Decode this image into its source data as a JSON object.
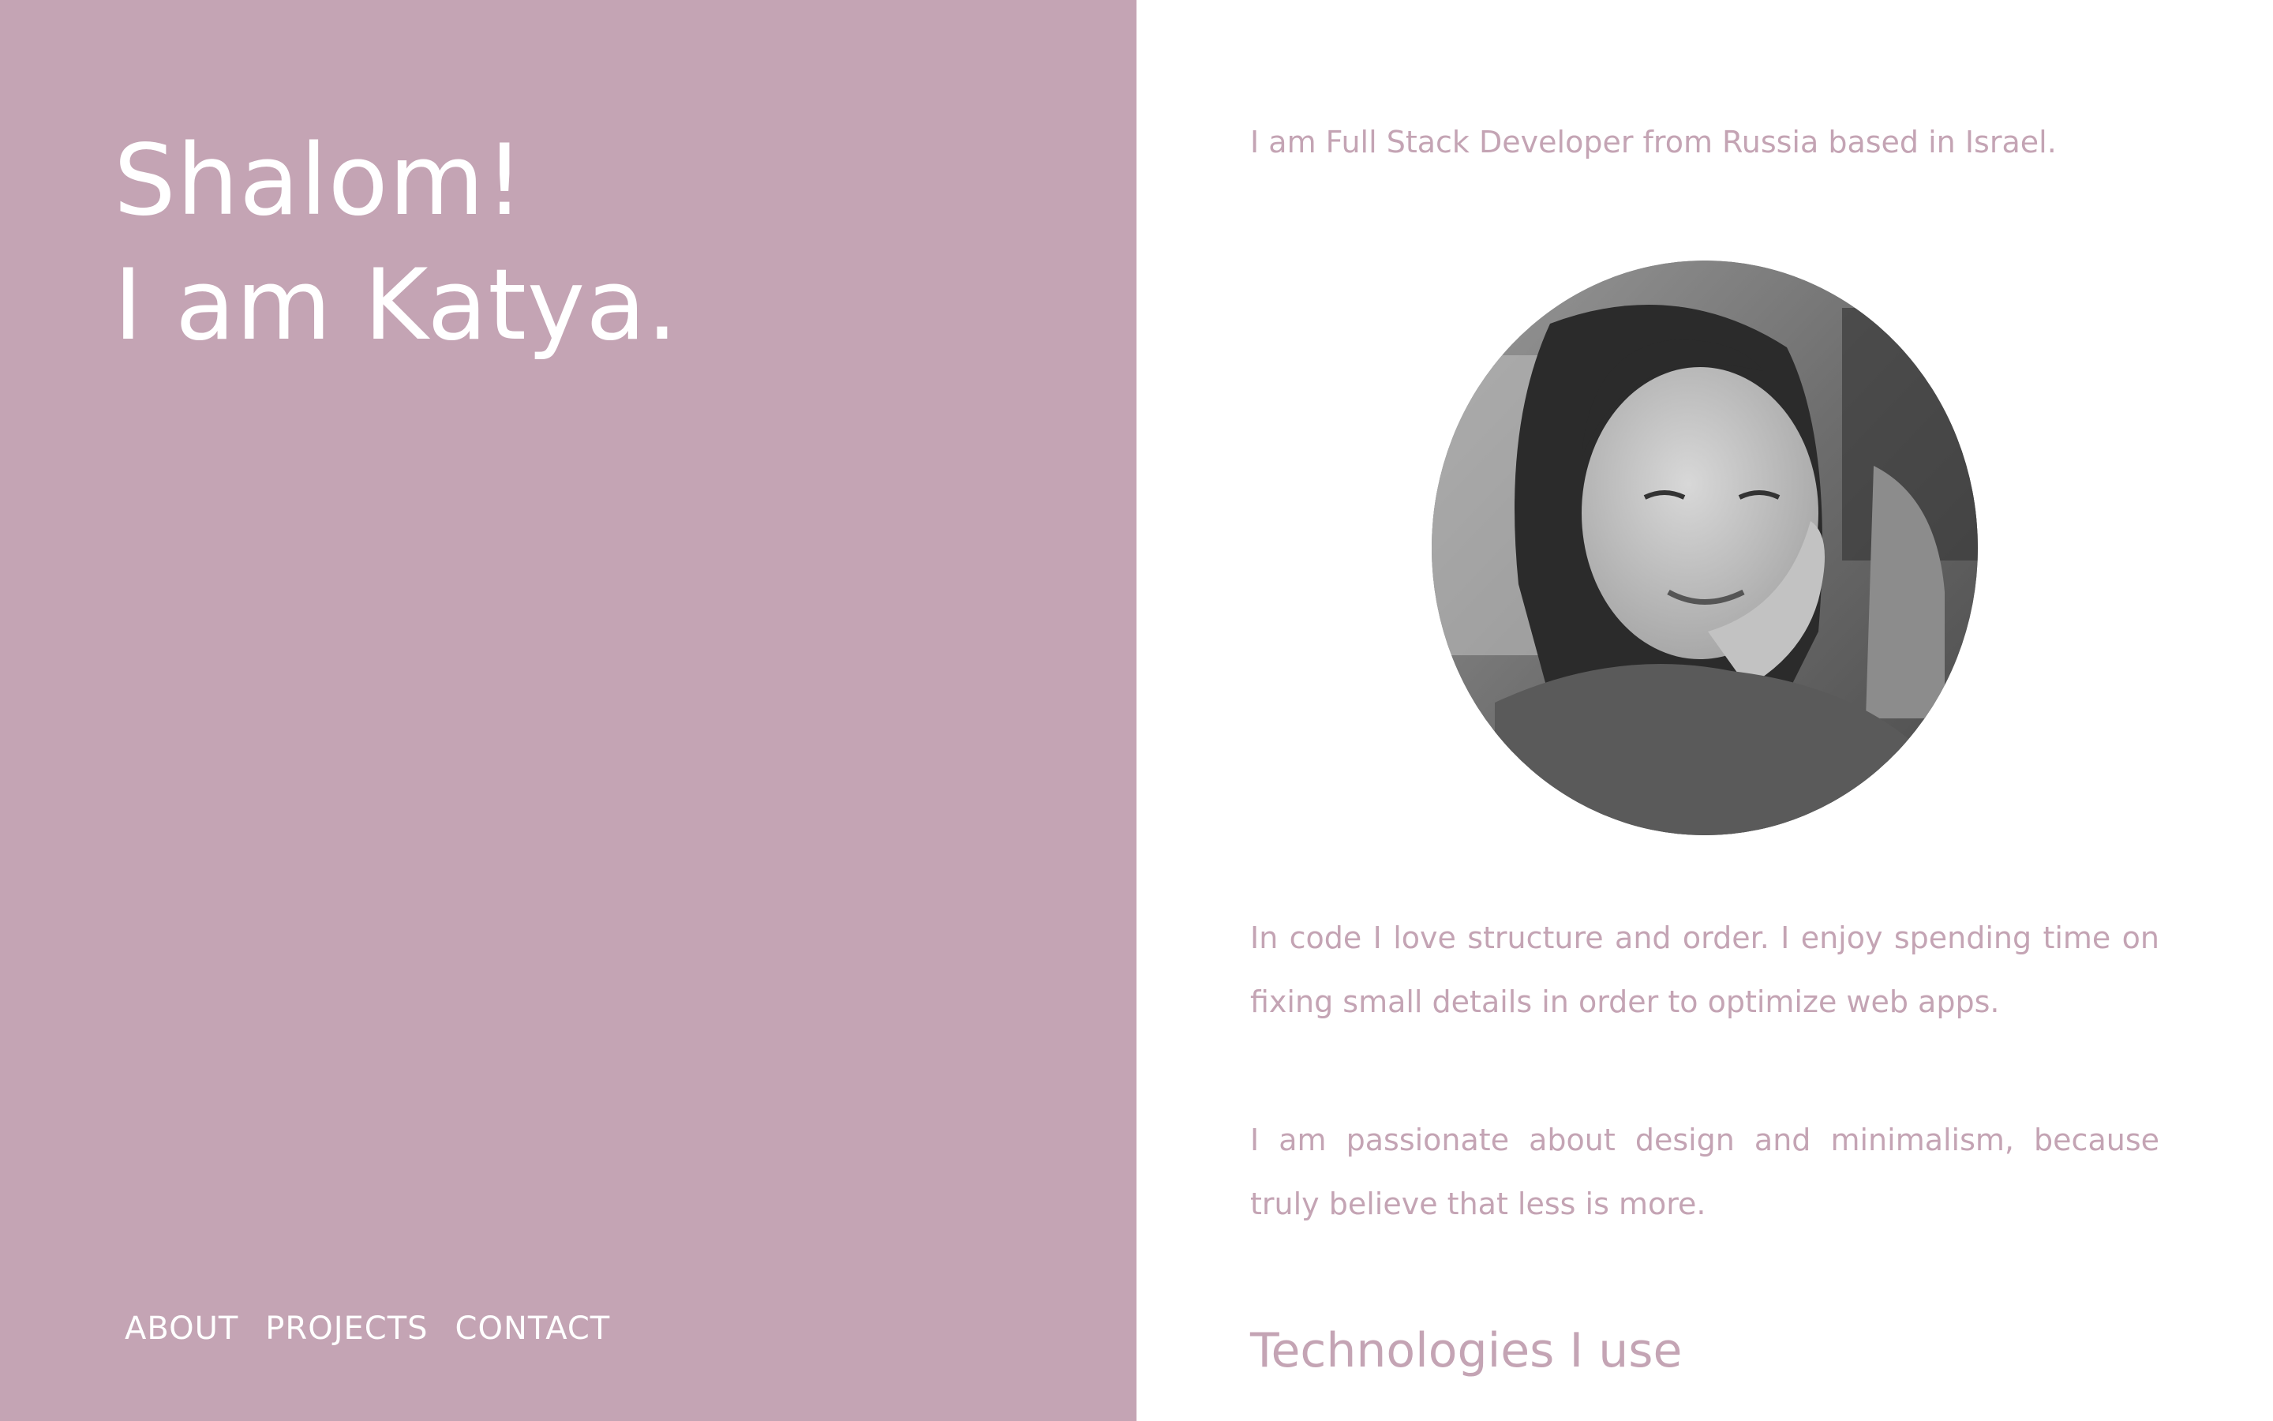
{
  "colors": {
    "accent": "#c4a4b4",
    "panel_text": "#ffffff",
    "background": "#ffffff"
  },
  "hero": {
    "line1": "Shalom!",
    "line2": "I am Katya."
  },
  "nav": {
    "items": [
      {
        "label": "ABOUT"
      },
      {
        "label": "PROJECTS"
      },
      {
        "label": "CONTACT"
      }
    ]
  },
  "about": {
    "intro": "I am Full Stack Developer from Russia based in Israel.",
    "paragraphs": [
      "In code I love structure and order. I enjoy spending time on fixing small details in order to optimize web apps.",
      "I am passionate about design and minimalism, because truly believe that less is more."
    ],
    "technologies_heading": "Technologies I use"
  }
}
